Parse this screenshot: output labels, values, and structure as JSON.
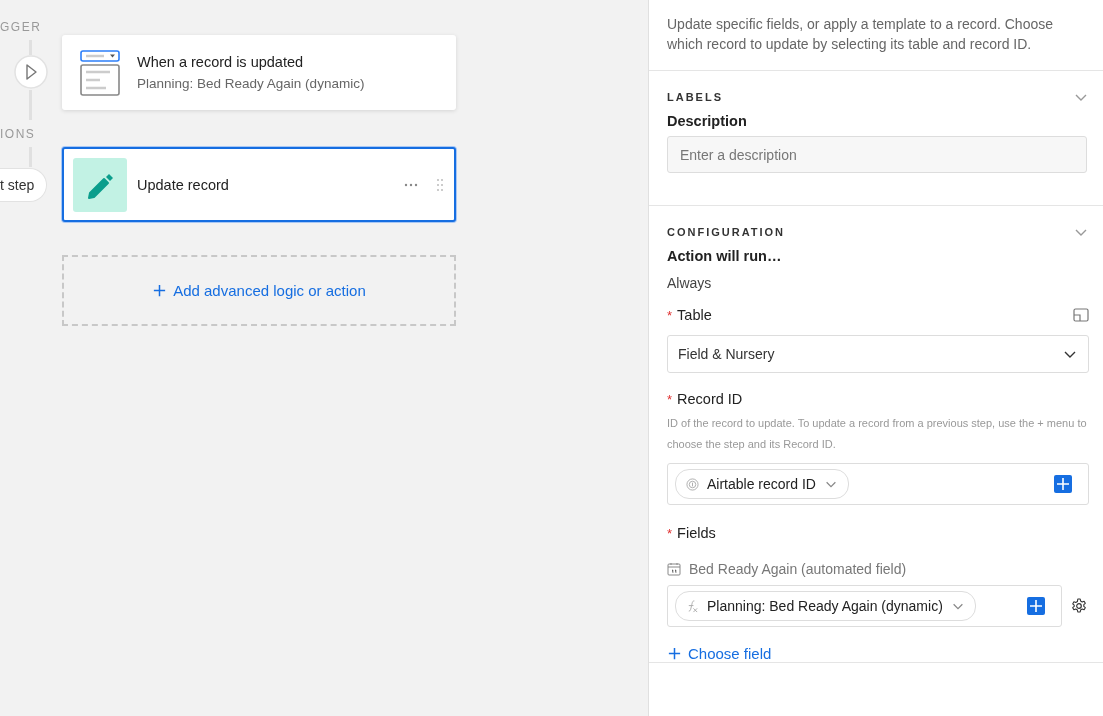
{
  "canvas": {
    "section_labels": [
      {
        "label": "GGER"
      },
      {
        "label": "IONS"
      }
    ],
    "add_step_button": {
      "label": "t step"
    },
    "steps": [
      {
        "kind": "trigger",
        "title": "When a record is updated",
        "subtitle": "Planning: Bed Ready Again (dynamic)",
        "selected": false
      },
      {
        "kind": "action",
        "title": "Update record",
        "selected": true
      }
    ],
    "add_logic_button": {
      "label": "Add advanced logic or action"
    }
  },
  "panel": {
    "intro": "Update specific fields, or apply a template to a record. Choose which record to update by selecting its table and record ID.",
    "labels_section": {
      "heading": "LABELS",
      "description_label": "Description",
      "description_field": {
        "placeholder": "Enter a description"
      }
    },
    "configuration_section": {
      "heading": "CONFIGURATION",
      "run_label": "Action will run…",
      "run_value": "Always",
      "table": {
        "required_mark": "*",
        "label": "Table",
        "value": "Field & Nursery"
      },
      "record_id": {
        "required_mark": "*",
        "label": "Record ID",
        "help": "ID of the record to update. To update a record from a previous step, use the + menu to choose the step and its Record ID.",
        "token": "Airtable record ID"
      },
      "fields": {
        "required_mark": "*",
        "label": "Fields",
        "field_name": "Bed Ready Again (automated field)",
        "token": "Planning: Bed Ready Again (dynamic)"
      },
      "choose_field_button": {
        "label": "Choose field"
      }
    }
  }
}
